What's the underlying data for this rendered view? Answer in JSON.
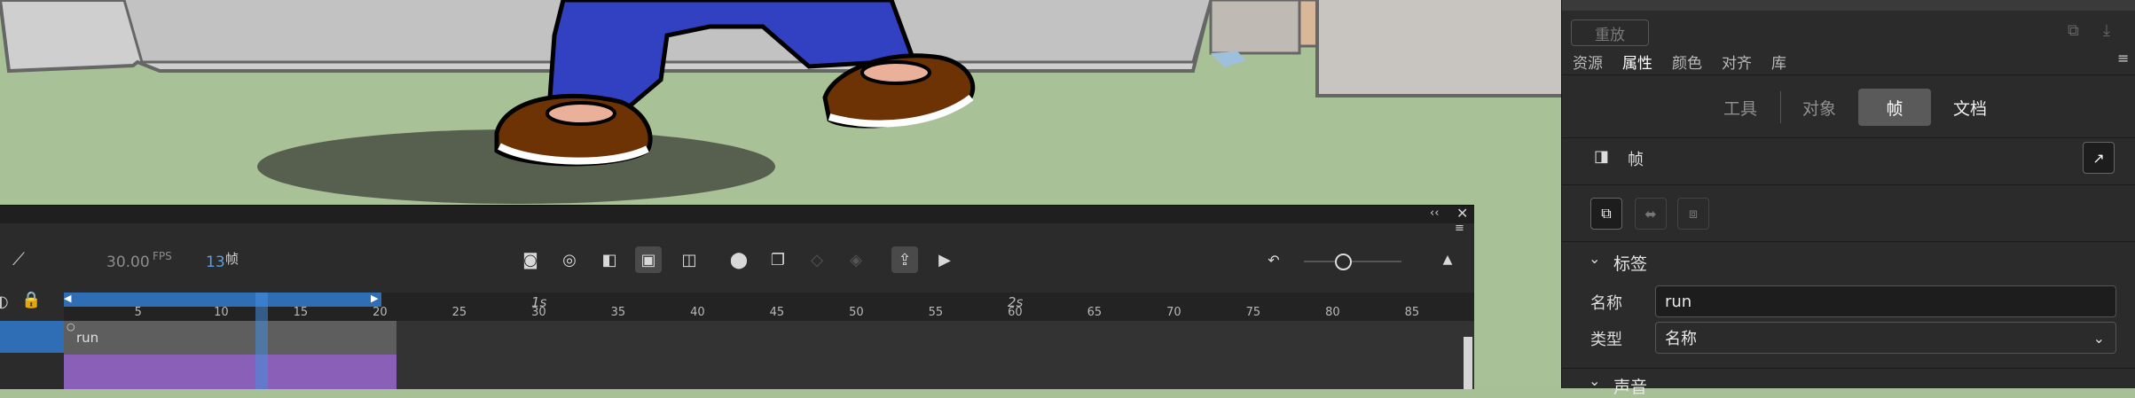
{
  "timeline": {
    "fps_value": "30.00",
    "fps_unit": "FPS",
    "frame_value": "13",
    "frame_unit": "帧",
    "layer_name": "run",
    "second_labels": [
      "1s",
      "2s"
    ],
    "frame_ticks": [
      "5",
      "10",
      "15",
      "20",
      "25",
      "30",
      "35",
      "40",
      "45",
      "50",
      "55",
      "60",
      "65",
      "70",
      "75",
      "80",
      "85"
    ]
  },
  "panel": {
    "replay_button": "重放",
    "tabs": [
      "资源",
      "属性",
      "颜色",
      "对齐",
      "库"
    ],
    "active_tab": "属性",
    "segments": [
      "工具",
      "对象",
      "帧",
      "文档"
    ],
    "active_segment": "帧",
    "section_title": "帧",
    "label_section": "标签",
    "name_label": "名称",
    "name_value": "run",
    "type_label": "类型",
    "type_value": "名称",
    "sound_section": "声音"
  },
  "colors": {
    "accent_blue": "#2f6db5",
    "layer_purple": "#8a5fb8",
    "panel_bg": "#2b2b2b"
  }
}
